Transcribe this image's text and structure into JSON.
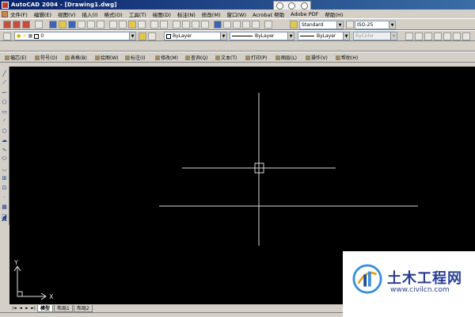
{
  "window": {
    "title": "AutoCAD 2004 - [Drawing1.dwg]"
  },
  "menu": [
    "文件(F)",
    "编辑(E)",
    "视图(V)",
    "插入(I)",
    "格式(O)",
    "工具(T)",
    "绘图(D)",
    "标注(N)",
    "修改(M)",
    "窗口(W)",
    "Acrobat 帮助",
    "Adobe PDF",
    "帮助(H)"
  ],
  "ime_bar": {
    "buttons": [
      "A",
      "J",
      "0"
    ]
  },
  "styles": {
    "text_style": "Standard",
    "dim_style": "ISO-25"
  },
  "layer": {
    "current": "0"
  },
  "properties": {
    "color": "ByLayer",
    "linetype": "ByLayer",
    "lineweight": "ByLayer",
    "plotstyle": "ByColor"
  },
  "express_menu": [
    "幅芯(E)",
    "符号(O)",
    "表格(B)",
    "绘图(W)",
    "标注(I)",
    "修改(M)",
    "查询(Q)",
    "文本(T)",
    "打印(P)",
    "图层(L)",
    "操作(V)",
    "帮助(H)"
  ],
  "canvas": {
    "background": "#000000",
    "line_color": "#d8d8d8",
    "ucs_labels": {
      "x": "X",
      "y": "Y"
    }
  },
  "tabs": {
    "nav": [
      "|◄",
      "◄",
      "►",
      "►|"
    ],
    "items": [
      "模型",
      "布局1",
      "布局2"
    ],
    "active": "模型"
  },
  "watermark": {
    "name": "土木工程网",
    "url": "www.civilcn.com"
  }
}
